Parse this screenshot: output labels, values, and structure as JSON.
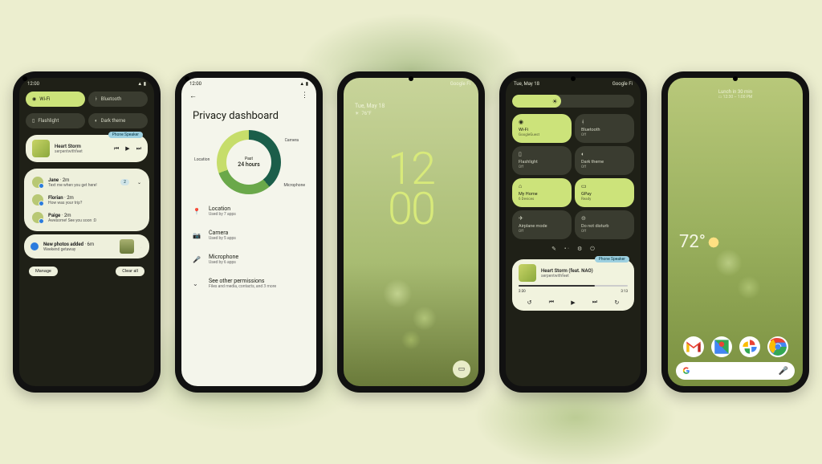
{
  "phone1": {
    "time": "12:00",
    "qs": {
      "wifi": "Wi-Fi",
      "bluetooth": "Bluetooth",
      "flashlight": "Flashlight",
      "darktheme": "Dark theme"
    },
    "media": {
      "badge": "Phone Speaker",
      "title": "Heart Storm",
      "artist": "serpentwithfeet"
    },
    "convos": [
      {
        "name": "Jane",
        "time": "2m",
        "msg": "Text me when you get here!",
        "count": "2"
      },
      {
        "name": "Florian",
        "time": "2m",
        "msg": "How was your trip?",
        "count": ""
      },
      {
        "name": "Paige",
        "time": "2m",
        "msg": "Awesome! See you soon :D",
        "count": ""
      }
    ],
    "photos": {
      "title": "New photos added",
      "time": "6m",
      "sub": "Weekend getaway"
    },
    "actions": {
      "manage": "Manage",
      "clear": "Clear all"
    }
  },
  "phone2": {
    "time": "12:00",
    "title": "Privacy dashboard",
    "donut": {
      "past": "Past",
      "duration": "24 hours"
    },
    "labels": {
      "location": "Location",
      "camera": "Camera",
      "microphone": "Microphone"
    },
    "items": [
      {
        "icon": "📍",
        "title": "Location",
        "sub": "Used by 7 apps"
      },
      {
        "icon": "📷",
        "title": "Camera",
        "sub": "Used by 5 apps"
      },
      {
        "icon": "🎤",
        "title": "Microphone",
        "sub": "Used by 6 apps"
      },
      {
        "icon": "⌄",
        "title": "See other permissions",
        "sub": "Files and media, contacts, and 3 more"
      }
    ]
  },
  "phone3": {
    "carrier": "Google Fi",
    "date": "Tue, May 18",
    "temp": "76°F",
    "clock_top": "12",
    "clock_bottom": "00"
  },
  "phone4": {
    "date": "Tue, May 18",
    "carrier": "Google Fi",
    "tiles": [
      {
        "label": "Wi-Fi",
        "sub": "GoogleGuest",
        "on": true
      },
      {
        "label": "Bluetooth",
        "sub": "Off",
        "on": false
      },
      {
        "label": "Flashlight",
        "sub": "Off",
        "on": false
      },
      {
        "label": "Dark theme",
        "sub": "Off",
        "on": false
      },
      {
        "label": "My Home",
        "sub": "6 Devices",
        "on": true
      },
      {
        "label": "GPay",
        "sub": "Ready",
        "on": true
      },
      {
        "label": "Airplane mode",
        "sub": "Off",
        "on": false
      },
      {
        "label": "Do not disturb",
        "sub": "Off",
        "on": false
      }
    ],
    "media": {
      "badge": "Phone Speaker",
      "title": "Heart Storm (feat. NAO)",
      "artist": "serpentwithfeet",
      "elapsed": "2:20",
      "total": "3:13"
    }
  },
  "phone5": {
    "glance": {
      "title": "Lunch in 30 min",
      "sub": "12:30 – 1:00 PM"
    },
    "weather": "72°",
    "search_letter": "G"
  }
}
